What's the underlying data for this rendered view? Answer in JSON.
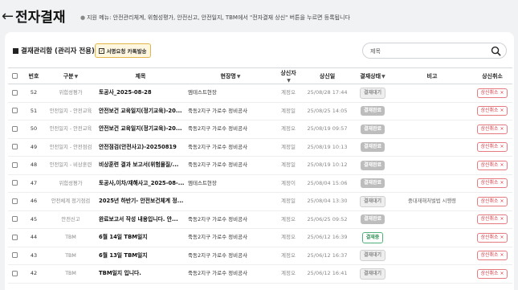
{
  "header": {
    "back_icon": "arrow-left-icon",
    "title": "전자결재",
    "notice": "지원 메뉴: 안전관리체계, 위험성평가, 안전신고, 안전일지, TBM에서 \"전자결재 상신\" 버튼을 누르면 등록됩니다"
  },
  "section": {
    "title": "결재관리함 (관리자 전용)",
    "sign_button_label": "서명요청 카톡발송"
  },
  "search": {
    "placeholder": "제목",
    "icon": "search-icon"
  },
  "columns": {
    "no": "번호",
    "category": "구분",
    "subject": "제목",
    "site": "현장명",
    "submitter": "상신자",
    "date": "상신일",
    "status": "결재상태",
    "note": "비고",
    "cancel": "상신취소"
  },
  "cancel_label": "상신취소",
  "rows": [
    {
      "no": "52",
      "category": "위험성평가",
      "subject": "토공사_2025-08-28",
      "site": "엠테스트현장",
      "submitter": "계정오",
      "date": "25/08/28 17:44",
      "status": "결재대기",
      "status_type": "wait",
      "note": ""
    },
    {
      "no": "51",
      "category": "안전일지 - 안전교육",
      "subject": "안전보건 교육일지(정기교육)-20...",
      "site": "죽동2지구 가로수 정비공사",
      "submitter": "계정일",
      "date": "25/08/25 14:05",
      "status": "결재완료",
      "status_type": "done",
      "note": ""
    },
    {
      "no": "50",
      "category": "안전일지 - 안전교육",
      "subject": "안전보건 교육일지(정기교육)-20...",
      "site": "죽동2지구 가로수 정비공사",
      "submitter": "계정오",
      "date": "25/08/19 09:57",
      "status": "결재완료",
      "status_type": "done",
      "note": ""
    },
    {
      "no": "49",
      "category": "안전일지 - 안전점검",
      "subject": "안전점검(안전사고)-20250819",
      "site": "죽동2지구 가로수 정비공사",
      "submitter": "계정일",
      "date": "25/08/19 10:13",
      "status": "결재완료",
      "status_type": "done",
      "note": ""
    },
    {
      "no": "48",
      "category": "안전일지 - 비상훈련",
      "subject": "비상훈련 결과 보고서(위험물질/...",
      "site": "죽동2지구 가로수 정비공사",
      "submitter": "계정일",
      "date": "25/08/19 10:12",
      "status": "결재완료",
      "status_type": "done",
      "note": ""
    },
    {
      "no": "47",
      "category": "위험성평가",
      "subject": "토공사,이차/재해사고_2025-08-...",
      "site": "엠테스트현장",
      "submitter": "계정이",
      "date": "25/08/04 15:06",
      "status": "결재완료",
      "status_type": "done",
      "note": ""
    },
    {
      "no": "46",
      "category": "안전체계 정기점검",
      "subject": "2025년 하반기- 안전보건체계 정...",
      "site": "",
      "submitter": "계정일",
      "date": "25/08/04 13:30",
      "status": "결재대기",
      "status_type": "wait",
      "note": "중대재해처벌법 시행령"
    },
    {
      "no": "45",
      "category": "안전신고",
      "subject": "완료보고서 작성 내용입니다. 안...",
      "site": "죽동2지구 가로수 정비공사",
      "submitter": "계정오",
      "date": "25/06/25 09:52",
      "status": "결재완료",
      "status_type": "done",
      "note": ""
    },
    {
      "no": "44",
      "category": "TBM",
      "subject": "6월 14일 TBM일지",
      "site": "죽동2지구 가로수 정비공사",
      "submitter": "계정오",
      "date": "25/06/12 16:39",
      "status": "결재중",
      "status_type": "prog",
      "note": ""
    },
    {
      "no": "43",
      "category": "TBM",
      "subject": "6월 13일 TBM일지",
      "site": "죽동2지구 가로수 정비공사",
      "submitter": "계정오",
      "date": "25/06/12 16:37",
      "status": "결재대기",
      "status_type": "wait",
      "note": ""
    },
    {
      "no": "42",
      "category": "TBM",
      "subject": "TBM일지 입니다.",
      "site": "죽동2지구 가로수 정비공사",
      "submitter": "계정오",
      "date": "25/06/12 16:41",
      "status": "결재대기",
      "status_type": "wait",
      "note": ""
    }
  ]
}
